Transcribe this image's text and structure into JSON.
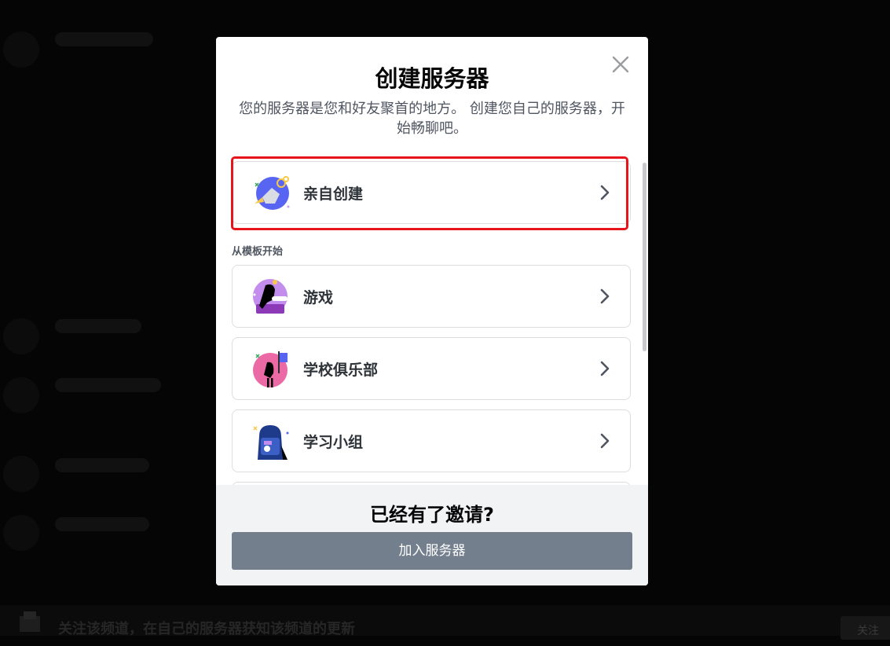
{
  "modal": {
    "title": "创建服务器",
    "subtitle": "您的服务器是您和好友聚首的地方。 创建您自己的服务器，开始畅聊吧。",
    "create_own": {
      "label": "亲自创建",
      "icon": "globe-build-icon"
    },
    "template_section_label": "从模板开始",
    "templates": [
      {
        "label": "游戏",
        "icon": "gaming-icon"
      },
      {
        "label": "学校俱乐部",
        "icon": "school-club-icon"
      },
      {
        "label": "学习小组",
        "icon": "study-group-icon"
      }
    ],
    "footer": {
      "title": "已经有了邀请?",
      "join_button": "加入服务器"
    }
  },
  "background": {
    "bottom_bar_text": "关注该频道，在自己的服务器获知该频道的更新",
    "follow_button": "关注"
  },
  "colors": {
    "highlight": "#e8141c",
    "join_button_bg": "#747f8d",
    "overlay": "#050505"
  }
}
